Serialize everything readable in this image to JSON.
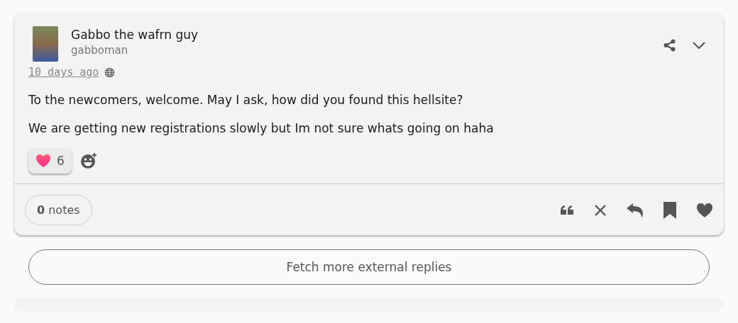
{
  "post": {
    "author": {
      "display_name": "Gabbo the wafrn guy",
      "handle": "gabboman"
    },
    "time": "10 days ago",
    "paragraphs": [
      "To the newcomers, welcome. May I ask, how did you found this hellsite?",
      "We are getting new registrations slowly but Im not sure whats going on haha"
    ],
    "reactions": [
      {
        "kind": "heart",
        "count": "6"
      }
    ],
    "notes": "**0** notes"
  },
  "fetch_button": "Fetch more external replies"
}
